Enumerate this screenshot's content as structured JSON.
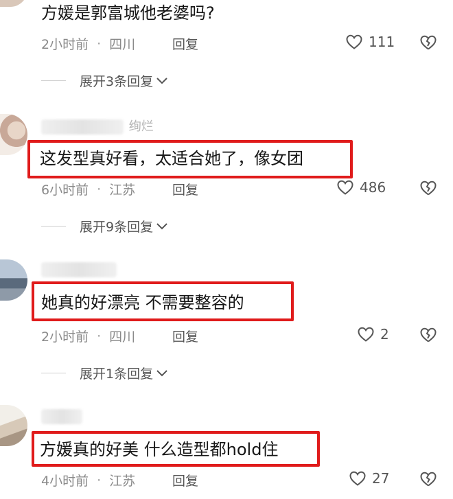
{
  "comments": [
    {
      "text": "方媛是郭富城他老婆吗?",
      "time": "2小时前",
      "location": "四川",
      "reply_label": "回复",
      "likes": "111",
      "expand": "展开3条回复"
    },
    {
      "username_tail": "绚烂",
      "text": "这发型真好看，太适合她了，像女团",
      "time": "6小时前",
      "location": "江苏",
      "reply_label": "回复",
      "likes": "486",
      "expand": "展开9条回复"
    },
    {
      "text": "她真的好漂亮 不需要整容的",
      "time": "2小时前",
      "location": "四川",
      "reply_label": "回复",
      "likes": "2",
      "expand": "展开1条回复"
    },
    {
      "text": "方媛真的好美 什么造型都hold住",
      "time": "4小时前",
      "location": "江苏",
      "reply_label": "回复",
      "likes": "27"
    }
  ],
  "colors": {
    "highlight": "#e01b1b",
    "meta": "#8a8a8a"
  },
  "icons": [
    "heart-outline-icon",
    "broken-heart-icon",
    "chevron-down-icon"
  ]
}
